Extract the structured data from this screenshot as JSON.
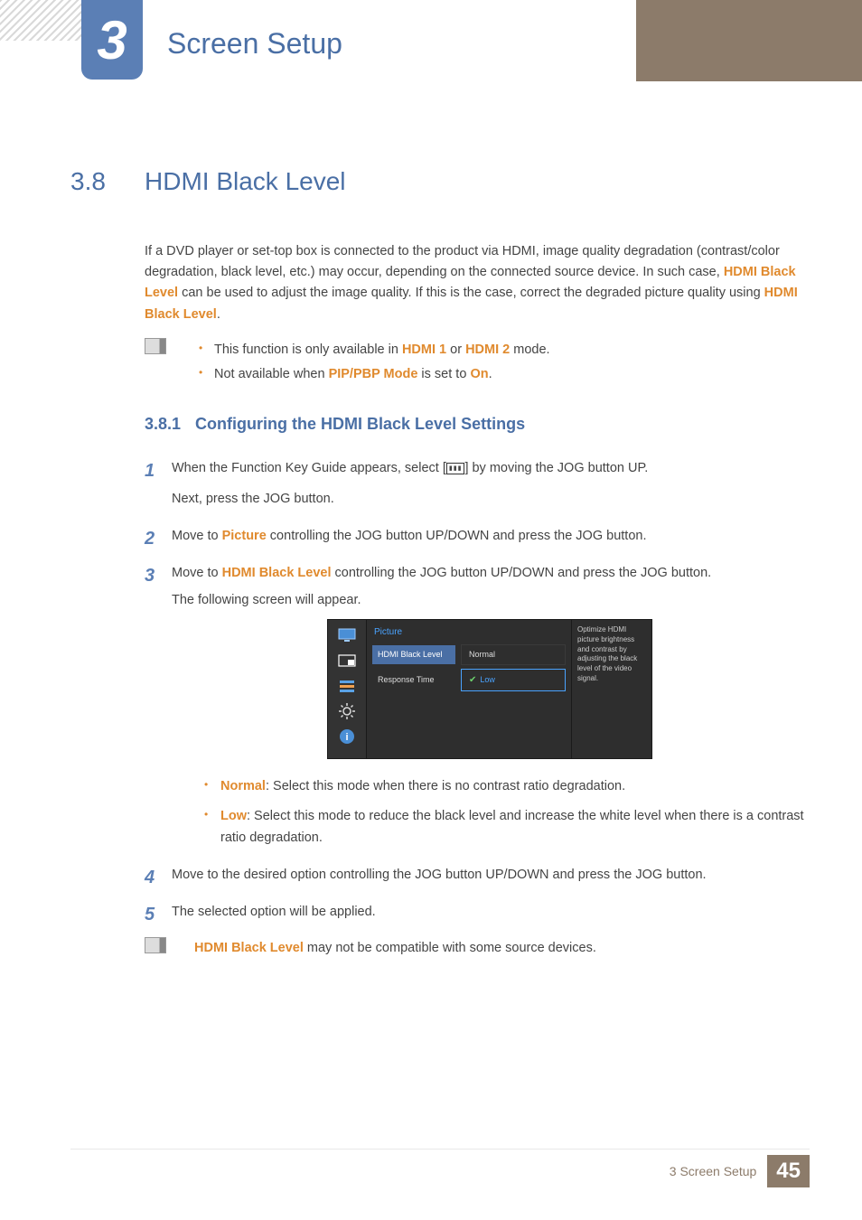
{
  "chapter": {
    "number": "3",
    "title": "Screen Setup"
  },
  "section": {
    "number": "3.8",
    "title": "HDMI Black Level"
  },
  "intro": {
    "prefix": "If a DVD player or set-top box is connected to the product via HDMI, image quality degradation (contrast/color degradation, black level, etc.) may occur, depending on the connected source device. In such case, ",
    "hl1": "HDMI Black Level",
    "middle": " can be used to adjust the image quality. If this is the case, correct the degraded picture quality using ",
    "hl2": "HDMI Black Level",
    "suffix": "."
  },
  "notes1": {
    "a": {
      "pre": "This function is only available in ",
      "hl1": "HDMI 1",
      "mid": " or ",
      "hl2": "HDMI 2",
      "post": " mode."
    },
    "b": {
      "pre": "Not available when ",
      "hl1": "PIP/PBP Mode",
      "mid": " is set to ",
      "hl2": "On",
      "post": "."
    }
  },
  "subsection": {
    "number": "3.8.1",
    "title": "Configuring the HDMI Black Level Settings"
  },
  "steps": {
    "s1": {
      "line1a": "When the Function Key Guide appears, select [",
      "line1b": "] by moving the JOG button UP.",
      "line2": "Next, press the JOG button."
    },
    "s2": {
      "pre": "Move to ",
      "hl": "Picture",
      "post": " controlling the JOG button UP/DOWN and press the JOG button."
    },
    "s3": {
      "pre": "Move to ",
      "hl": "HDMI Black Level",
      "post": " controlling the JOG button UP/DOWN and press the JOG button.",
      "line2": "The following screen will appear."
    },
    "s4": "Move to the desired option controlling the JOG button UP/DOWN and press the JOG button.",
    "s5": "The selected option will be applied."
  },
  "markers": {
    "m1": "1",
    "m2": "2",
    "m3": "3",
    "m4": "4",
    "m5": "5"
  },
  "osd": {
    "title": "Picture",
    "item1": "HDMI Black Level",
    "item2": "Response Time",
    "opt1": "Normal",
    "opt2": "Low",
    "hint": "Optimize HDMI picture brightness and contrast by adjusting the black level of the video signal."
  },
  "options": {
    "normal": {
      "label": "Normal",
      "desc": ": Select this mode when there is no contrast ratio degradation."
    },
    "low": {
      "label": "Low",
      "desc": ": Select this mode to reduce the black level and increase the white level when there is a contrast ratio degradation."
    }
  },
  "note2": {
    "hl": "HDMI Black Level",
    "post": " may not be compatible with some source devices."
  },
  "footer": {
    "text": "3 Screen Setup",
    "page": "45"
  }
}
